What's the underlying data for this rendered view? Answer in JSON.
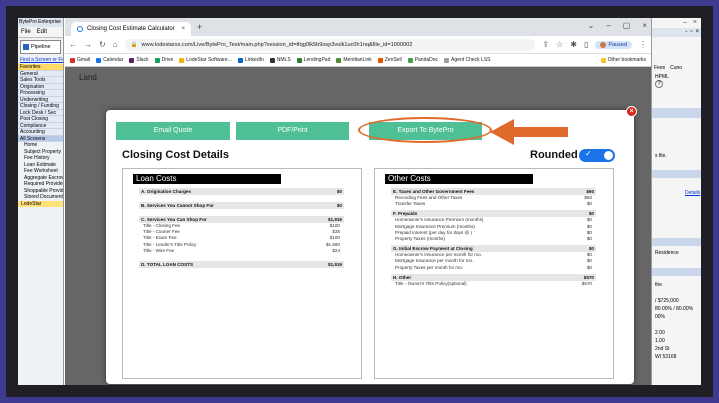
{
  "left_app": {
    "title": "BytePro Enterprise",
    "menu": [
      "File",
      "Edit"
    ],
    "pipeline_label": "Pipeline",
    "find_link": "Find a Screen or Field",
    "nav": [
      "Favorites",
      "General",
      "Sales Tools",
      "Origination",
      "Processing",
      "Underwriting",
      "Closing / Funding",
      "Lock Desk / Sec",
      "Post Closing",
      "Compliance",
      "Accounting",
      "All Screens"
    ],
    "tree": [
      "Home",
      "Subject Property",
      "Fee History",
      "Loan Estimate",
      "Fee Worksheet",
      "Aggregate Escrow",
      "Required Providers",
      "Shoppable Providers",
      "Stored Documents",
      "LodeStar"
    ]
  },
  "browser": {
    "tab_title": "Closing Cost Estimate Calculator",
    "url": "www.lodestarss.com/Live/BytePro_Test/main.php?session_id=tfqg0lk5b9osp3vulk1uc0h1nq&file_id=1000002",
    "profile": "Paused",
    "bookmarks": [
      "Gmail",
      "Calendar",
      "Slack",
      "Drive",
      "LodeStar Software...",
      "LinkedIn",
      "NMLS",
      "LendingPad",
      "MeridianLink",
      "ZenSell",
      "PandaDoc",
      "Agent Check LSS"
    ],
    "other_bookmarks": "Other bookmarks",
    "page_hint": "Land"
  },
  "right_app": {
    "icons": [
      "Fees",
      "Cuno",
      "HPML"
    ],
    "fragments": [
      "s file.",
      "Details",
      "Residence",
      "the",
      "/ $725,000",
      "80.00% / 80.00%",
      "00%",
      "2.00",
      "1.00",
      "2nd St",
      "WI 53168"
    ]
  },
  "modal": {
    "buttons": {
      "email_quote": "Email Quote",
      "pdf_print": "PDF/Print",
      "export": "Export To BytePro"
    },
    "title": "Closing Cost Details",
    "rounded_label": "Rounded",
    "rounded_on": true,
    "loan_costs": {
      "heading": "Loan Costs",
      "sections": [
        {
          "label": "A. Origination Charges",
          "amount": "$0",
          "items": []
        },
        {
          "label": "B. Services You Cannot Shop For",
          "amount": "$0",
          "items": []
        },
        {
          "label": "C. Services You Can Shop For",
          "amount": "$1,919",
          "items": [
            {
              "label": "Title - Closing Fee",
              "amount": "$100"
            },
            {
              "label": "Title - Courier Fee",
              "amount": "$35"
            },
            {
              "label": "Title - Exam Fee",
              "amount": "$100"
            },
            {
              "label": "Title - Lender's Title Policy",
              "amount": "$1,660"
            },
            {
              "label": "Title - Wire Fee",
              "amount": "$24"
            }
          ]
        },
        {
          "label": "D. TOTAL LOAN COSTS",
          "amount": "$1,919",
          "items": []
        }
      ]
    },
    "other_costs": {
      "heading": "Other Costs",
      "sections": [
        {
          "label": "E. Taxes and Other Government Fees",
          "amount": "$60",
          "items": [
            {
              "label": "Recording Fees and Other Taxes",
              "amount": "$60"
            },
            {
              "label": "Transfer Taxes",
              "amount": "$0"
            }
          ]
        },
        {
          "label": "F. Prepaids",
          "amount": "$0",
          "items": [
            {
              "label": "Homeowner's Insurance Premium (months)",
              "amount": "$0"
            },
            {
              "label": "Mortgage Insurance Premium (months)",
              "amount": "$0"
            },
            {
              "label": "Prepaid Interest (per day for days @ )",
              "amount": "$0"
            },
            {
              "label": "Property Taxes (months)",
              "amount": "$0"
            }
          ]
        },
        {
          "label": "G. Initial Escrow Payment at Closing",
          "amount": "$0",
          "items": [
            {
              "label": "Homeowner's Insurance per month for mo.",
              "amount": "$0"
            },
            {
              "label": "Mortgage Insurance per month for mo.",
              "amount": "$0"
            },
            {
              "label": "Property Taxes per month for mo.",
              "amount": "$0"
            }
          ]
        },
        {
          "label": "H. Other",
          "amount": "$570",
          "items": [
            {
              "label": "Title - Owner's Title Policy(optional)",
              "amount": "$570"
            }
          ]
        }
      ]
    }
  },
  "colors": {
    "button_green": "#4fbf95",
    "annotation_orange": "#e06a2c",
    "toggle_blue": "#1a73e8",
    "close_red": "#d9261c"
  }
}
